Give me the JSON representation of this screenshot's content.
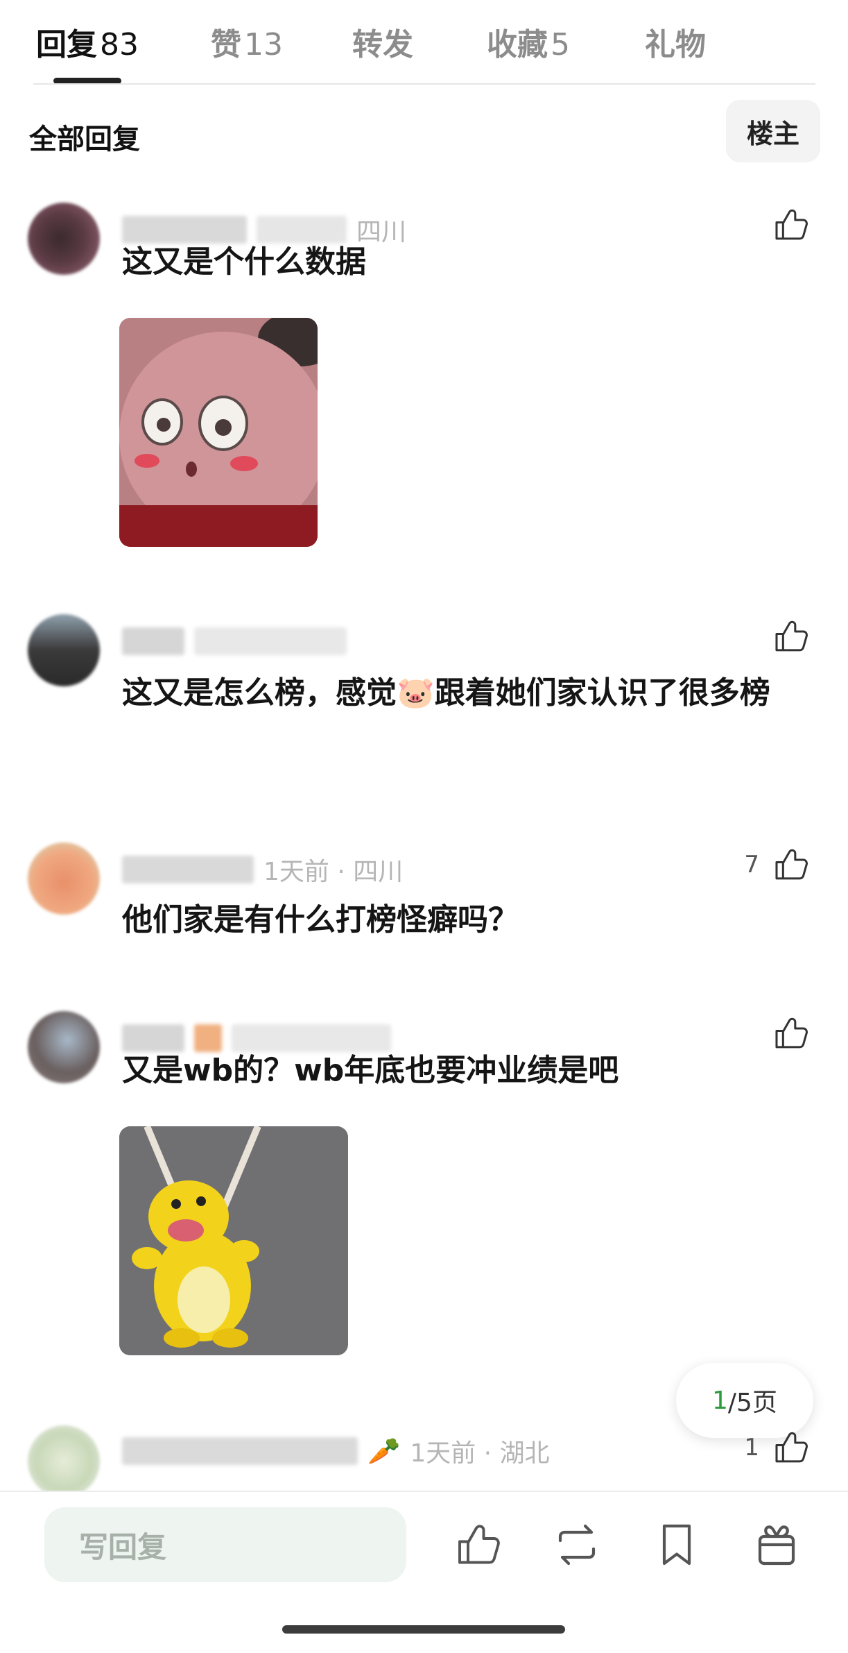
{
  "tabs": [
    {
      "label": "回复",
      "count": "83"
    },
    {
      "label": "赞",
      "count": "13"
    },
    {
      "label": "转发",
      "count": ""
    },
    {
      "label": "收藏",
      "count": "5"
    },
    {
      "label": "礼物",
      "count": ""
    }
  ],
  "filter": {
    "all_label": "全部回复",
    "op_label": "楼主"
  },
  "comments": [
    {
      "meta_visible": "四川",
      "text": "这又是个什么数据",
      "like_count": "",
      "image": "pink-plush-sticker"
    },
    {
      "meta_visible": "",
      "text": "这又是怎么榜，感觉🐷跟着她们家认识了很多榜",
      "like_count": "",
      "image": ""
    },
    {
      "meta_visible": "1天前 · 四川",
      "text": "他们家是有什么打榜怪癖吗？",
      "like_count": "7",
      "image": ""
    },
    {
      "meta_visible": "",
      "text": "又是wb的？wb年底也要冲业绩是吧",
      "like_count": "",
      "image": "yellow-dino-sticker"
    },
    {
      "meta_visible": "1天前 · 湖北",
      "text": "",
      "like_count": "1",
      "image": ""
    }
  ],
  "pager": {
    "current": "1",
    "total": "/5页"
  },
  "bottom_bar": {
    "reply_placeholder": "写回复",
    "icons": [
      "thumbs-up-icon",
      "repost-icon",
      "bookmark-icon",
      "gift-icon"
    ]
  },
  "colors": {
    "accent_green": "#2e9a3e",
    "reply_box_bg": "#eef4ef",
    "muted_text": "#8c8c8c"
  }
}
